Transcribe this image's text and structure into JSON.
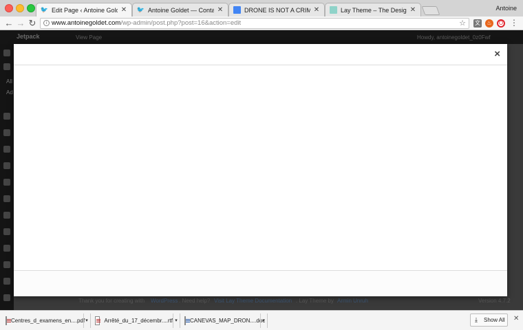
{
  "browser": {
    "profile_name": "Antoine",
    "tabs": [
      {
        "label": "Edit Page ‹ Antoine Goldet —",
        "icon": "wordpress-bird-icon",
        "active": true
      },
      {
        "label": "Antoine Goldet — Contact +",
        "icon": "wordpress-bird-icon",
        "active": false
      },
      {
        "label": "DRONE IS NOT A CRIME - Goo",
        "icon": "google-docs-icon",
        "active": false
      },
      {
        "label": "Lay Theme – The Designer's P",
        "icon": "lay-theme-icon",
        "active": false
      }
    ],
    "tab_close_glyph": "✕",
    "address": {
      "host": "www.antoinegoldet.com",
      "path": "/wp-admin/post.php?post=16&action=edit"
    },
    "back_glyph": "←",
    "forward_glyph": "→",
    "reload_glyph": "↻",
    "bookmark_glyph": "☆",
    "menu_glyph": "⋮"
  },
  "background_page": {
    "adminbar": {
      "left_label": "Jetpack",
      "view_page": "View Page",
      "howdy": "Howdy, antoinegoldet_0z0Fwf"
    },
    "sidebar_labels": [
      "All",
      "Ad"
    ],
    "footer": {
      "thanks": "Thank you for creating with",
      "wordpress": "WordPress",
      "need_help": ". Need help?",
      "docs_link": "Visit Lay Theme Documentation",
      "lay_theme_by": ". Lay Theme by",
      "author": "Armin Unruh",
      "version": "Version 4.7.2"
    }
  },
  "modal": {
    "close_glyph": "×"
  },
  "downloads": {
    "items": [
      {
        "label": "Centres_d_examens_en....pdf",
        "type": "pdf"
      },
      {
        "label": "Arrêté_du_17_décembr....rtf",
        "type": "rtf"
      },
      {
        "label": "CANEVAS_MAP_DRON....doc",
        "type": "doc"
      }
    ],
    "caret_glyph": "▾",
    "show_all": "Show All",
    "download_glyph": "⤓",
    "close_glyph": "✕"
  },
  "colors": {
    "traffic_red": "#fc5f57",
    "traffic_yellow": "#fdbc2e",
    "traffic_green": "#28c840",
    "overlay": "#3a3a3a"
  }
}
